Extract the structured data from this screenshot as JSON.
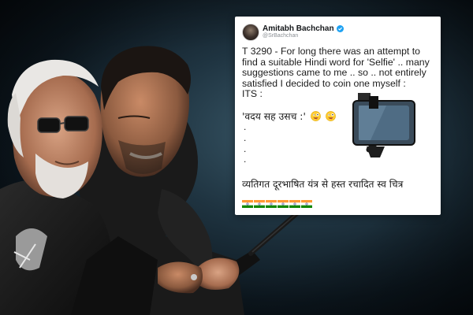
{
  "tweet": {
    "display_name": "Amitabh Bachchan",
    "handle": "@SrBachchan",
    "lines": [
      "T 3290 - For long there was an attempt to",
      "find a suitable Hindi word for 'Selfie' .. many",
      "suggestions came to me .. so .. not entirely",
      "satisfied I decided to coin one myself :",
      "ITS :"
    ],
    "hindi_acronym": "'वदय सह उसच :'",
    "dots": [
      ".",
      ".",
      ".",
      "."
    ],
    "hindi_full": "व्यतिगत दूरभाषित यंत्र से हस्त रचादित स्व चित्र",
    "emojis": [
      "crazy-face-emoji",
      "crazy-face-emoji"
    ],
    "flags": [
      "india-flag",
      "india-flag",
      "india-flag",
      "india-flag",
      "india-flag",
      "india-flag"
    ]
  },
  "colors": {
    "verified": "#1da1f2",
    "saffron": "#ff9933",
    "green": "#138808",
    "chakra": "#000080"
  }
}
